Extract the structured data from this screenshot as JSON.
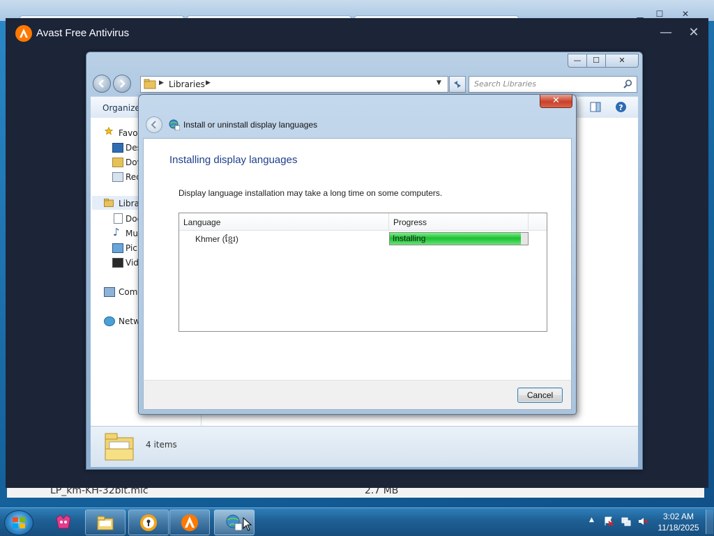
{
  "avast": {
    "title": "Avast Free Antivirus",
    "minimize_symbol": "—",
    "close_symbol": "✕"
  },
  "background": {
    "file_row_name": "LP_km-KH-32bit.mlc",
    "file_row_size": "2.7 MB"
  },
  "explorer": {
    "address_label": "Libraries",
    "search_placeholder": "Search Libraries",
    "toolbar_organize": "Organize",
    "nav": {
      "favorites": "Favor",
      "desktop": "Des",
      "downloads": "Dov",
      "recent": "Rec",
      "libraries": "Libra",
      "documents": "Doc",
      "music": "Mu",
      "pictures": "Pic",
      "videos": "Vid",
      "computer": "Com",
      "network": "Netw"
    },
    "status_count": "4 items",
    "min_symbol": "—",
    "max_symbol": "☐",
    "close_symbol": "✕"
  },
  "dialog": {
    "title": "Install or uninstall display languages",
    "heading": "Installing display languages",
    "description": "Display language installation may take a long time on some computers.",
    "columns": {
      "language": "Language",
      "progress": "Progress"
    },
    "rows": [
      {
        "language": "Khmer (ខ្មែរ)",
        "status": "Installing",
        "progress": 0.95
      }
    ],
    "cancel_label": "Cancel",
    "close_symbol": "✕"
  },
  "taskbar": {
    "time": "3:02 AM",
    "date": "11/18/2025",
    "items": [
      "paint-app-icon",
      "file-explorer-icon",
      "password-manager-icon",
      "avast-icon",
      "language-settings-icon"
    ]
  },
  "colors": {
    "avast_orange": "#ff7800",
    "heading_blue": "#1e3f8a",
    "progress_green": "#23c93a"
  }
}
